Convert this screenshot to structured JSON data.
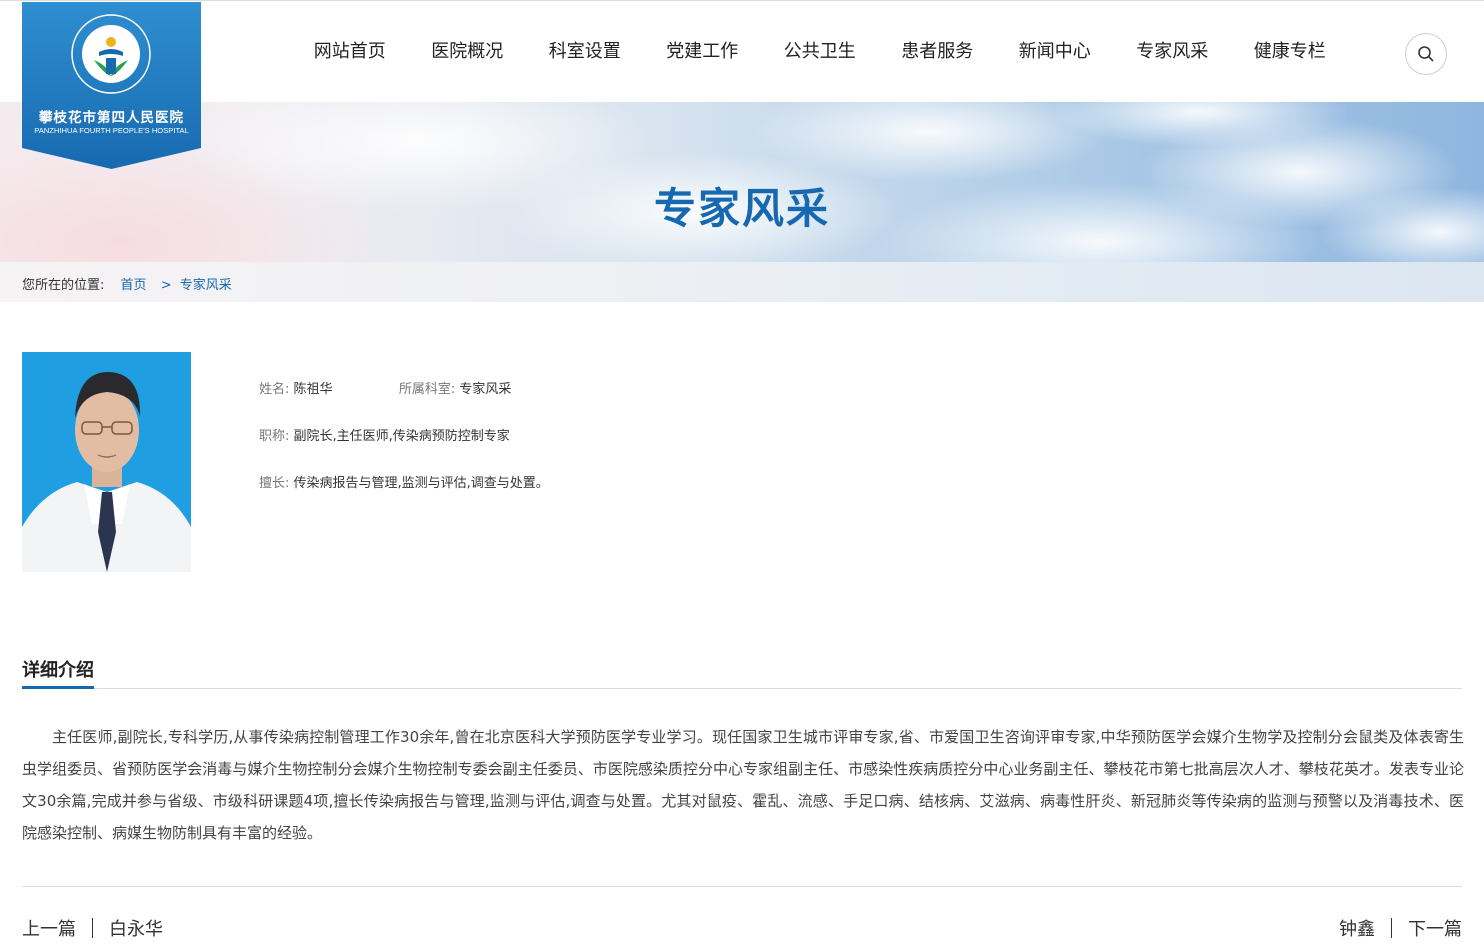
{
  "logo": {
    "name_cn": "攀枝花市第四人民医院",
    "name_en": "PANZHIHUA FOURTH PEOPLE'S HOSPITAL",
    "ring_text": "攀枝花市第四人民医院"
  },
  "nav": {
    "items": [
      "网站首页",
      "医院概况",
      "科室设置",
      "党建工作",
      "公共卫生",
      "患者服务",
      "新闻中心",
      "专家风采",
      "健康专栏"
    ],
    "search_icon": "search-icon"
  },
  "banner": {
    "title": "专家风采"
  },
  "breadcrumb": {
    "prefix": "您所在的位置:",
    "home": "首页",
    "separator": ">",
    "current": "专家风采"
  },
  "profile": {
    "name_label": "姓名:",
    "name": "陈祖华",
    "dept_label": "所属科室:",
    "dept": "专家风采",
    "title_label": "职称:",
    "title": "副院长,主任医师,传染病预防控制专家",
    "specialty_label": "擅长:",
    "specialty": "传染病报告与管理,监测与评估,调查与处置。"
  },
  "detail": {
    "heading": "详细介绍",
    "text": "主任医师,副院长,专科学历,从事传染病控制管理工作30余年,曾在北京医科大学预防医学专业学习。现任国家卫生城市评审专家,省、市爱国卫生咨询评审专家,中华预防医学会媒介生物学及控制分会鼠类及体表寄生虫学组委员、省预防医学会消毒与媒介生物控制分会媒介生物控制专委会副主任委员、市医院感染质控分中心专家组副主任、市感染性疾病质控分中心业务副主任、攀枝花市第七批高层次人才、攀枝花英才。发表专业论文30余篇,完成并参与省级、市级科研课题4项,擅长传染病报告与管理,监测与评估,调查与处置。尤其对鼠疫、霍乱、流感、手足口病、结核病、艾滋病、病毒性肝炎、新冠肺炎等传染病的监测与预警以及消毒技术、医院感染控制、病媒生物防制具有丰富的经验。"
  },
  "pager": {
    "prev_label": "上一篇",
    "prev_title": "白永华",
    "next_title": "钟鑫",
    "next_label": "下一篇"
  },
  "colors": {
    "brand": "#1669b0",
    "logo_bg": "#1e7fc4"
  }
}
